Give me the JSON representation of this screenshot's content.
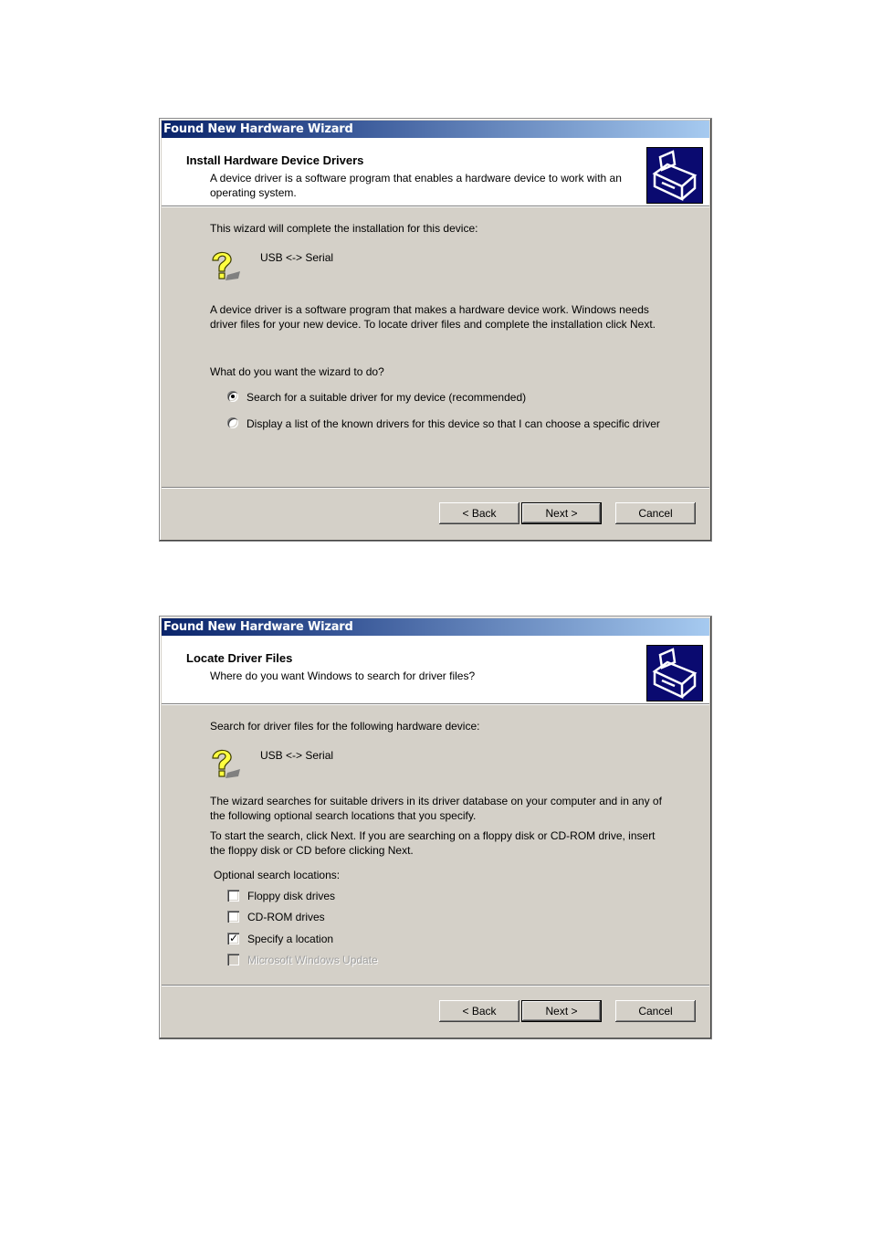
{
  "dialogs": [
    {
      "window_title": "Found New Hardware Wizard",
      "header_title": "Install Hardware Device Drivers",
      "header_subtitle": "A device driver is a software program that enables a hardware device to work with an operating system.",
      "intro": "This wizard will complete the installation for this device:",
      "device_name": "USB <-> Serial",
      "description": "A device driver is a software program that makes a hardware device work. Windows needs driver files for your new device. To locate driver files and complete the installation click Next.",
      "question": "What do you want the wizard to do?",
      "options": [
        {
          "label": "Search for a suitable driver for my device (recommended)",
          "selected": true
        },
        {
          "label": "Display a list of the known drivers for this device so that I can choose a specific driver",
          "selected": false
        }
      ],
      "buttons": {
        "back": "< Back",
        "next": "Next >",
        "cancel": "Cancel"
      }
    },
    {
      "window_title": "Found New Hardware Wizard",
      "header_title": "Locate Driver Files",
      "header_subtitle": "Where do you want Windows to search for driver files?",
      "intro": "Search for driver files for the following hardware device:",
      "device_name": "USB <-> Serial",
      "description1": "The wizard searches for suitable drivers in its driver database on your computer and in any of the following optional search locations that you specify.",
      "description2": "To start the search, click Next. If you are searching on a floppy disk or CD-ROM drive, insert the floppy disk or CD before clicking Next.",
      "locations_label": "Optional search locations:",
      "locations": [
        {
          "label": "Floppy disk drives",
          "checked": false,
          "enabled": true
        },
        {
          "label": "CD-ROM drives",
          "checked": false,
          "enabled": true
        },
        {
          "label": "Specify a location",
          "checked": true,
          "enabled": true
        },
        {
          "label": "Microsoft Windows Update",
          "checked": false,
          "enabled": false
        }
      ],
      "buttons": {
        "back": "< Back",
        "next": "Next >",
        "cancel": "Cancel"
      }
    }
  ]
}
